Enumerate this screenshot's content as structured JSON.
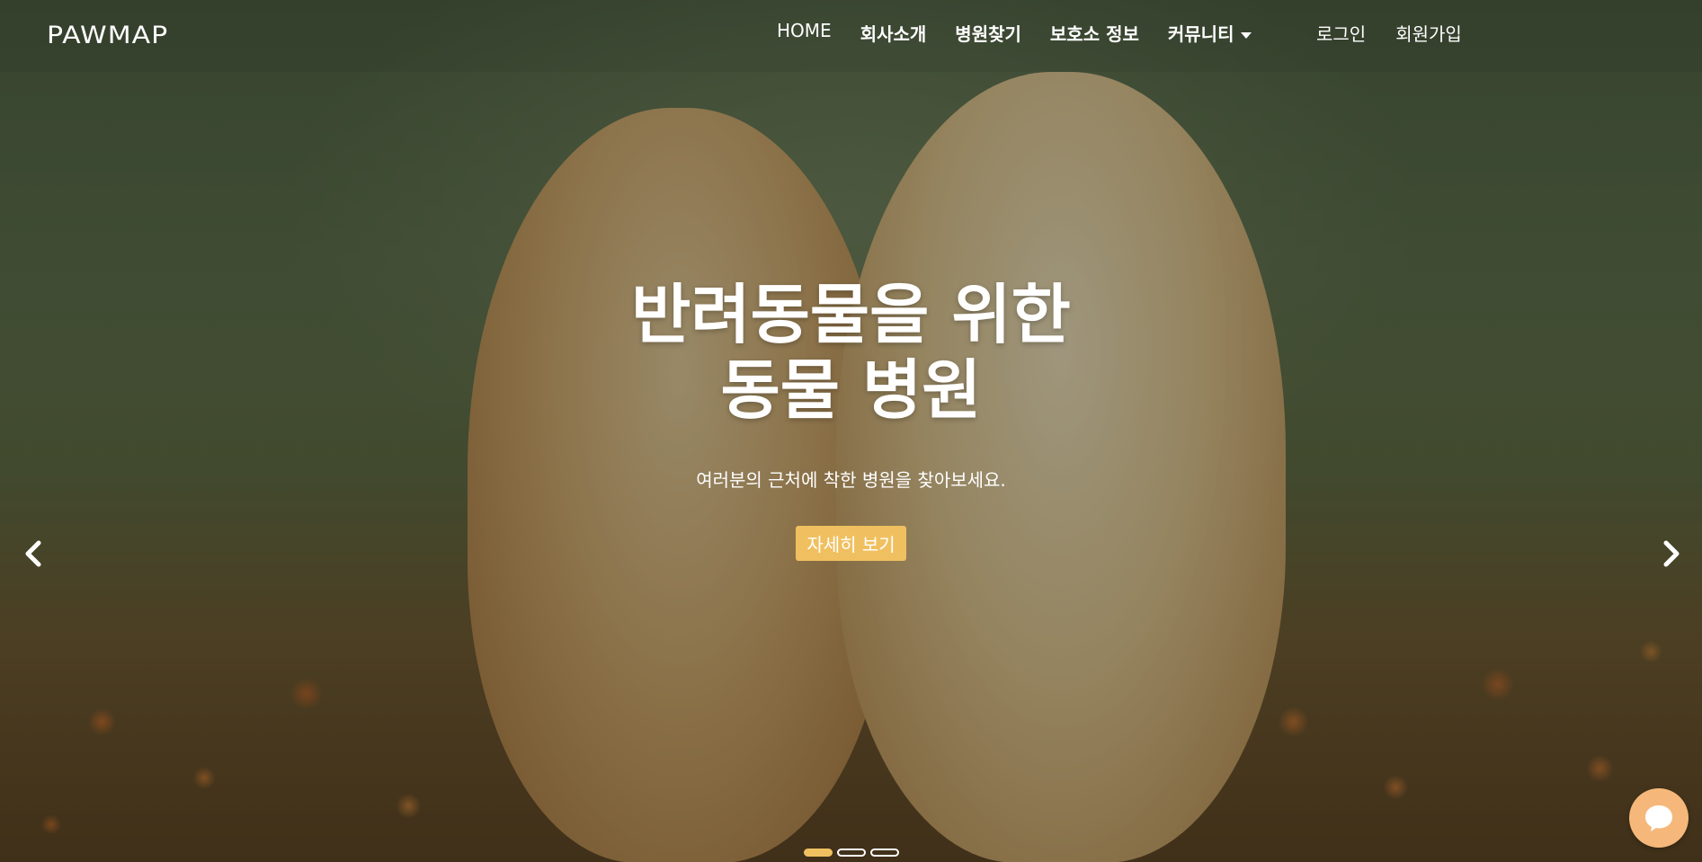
{
  "brand": {
    "logo_text": "PAWMAP"
  },
  "nav": {
    "links": [
      {
        "label": "HOME"
      },
      {
        "label": "회사소개"
      },
      {
        "label": "병원찾기"
      },
      {
        "label": "보호소 정보"
      },
      {
        "label": "커뮤니티"
      }
    ],
    "auth": {
      "login": "로그인",
      "signup": "회원가입"
    }
  },
  "hero": {
    "title_line1": "반려동물을 위한",
    "title_line2": "동물 병원",
    "subtitle": "여러분의 근처에 착한 병원을 찾아보세요.",
    "button_label": "자세히 보기"
  },
  "carousel": {
    "slide_count": 3,
    "active_index": 0
  },
  "colors": {
    "accent": "#f0c060",
    "chat": "#f5b87a",
    "text": "#ffffff"
  },
  "icons": {
    "prev": "chevron-left-icon",
    "next": "chevron-right-icon",
    "dropdown": "caret-down-icon",
    "chat": "chat-bubble-icon"
  }
}
